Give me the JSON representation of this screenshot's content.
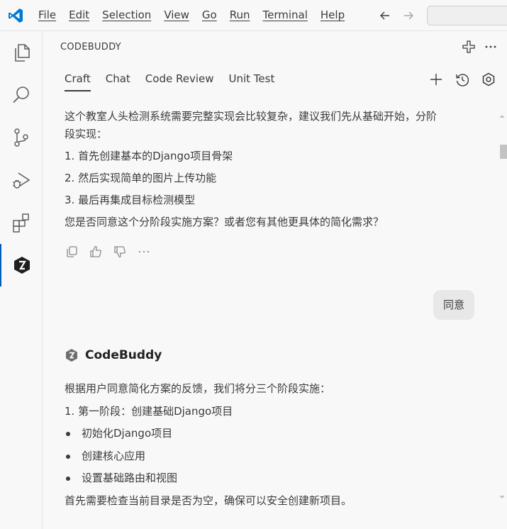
{
  "menu": [
    "File",
    "Edit",
    "Selection",
    "View",
    "Go",
    "Run",
    "Terminal",
    "Help"
  ],
  "panel": {
    "title": "CODEBUDDY",
    "tabs": [
      "Craft",
      "Chat",
      "Code Review",
      "Unit Test"
    ],
    "active_tab": "Craft"
  },
  "message1": {
    "clipped_line": "这个教室人头检测系统需要完整实现会比较复杂，建议我们先从基础开始，分阶",
    "lines": [
      "段实现：",
      "1. 首先创建基本的Django项目骨架",
      "2. 然后实现简单的图片上传功能",
      "3. 最后再集成目标检测模型",
      "您是否同意这个分阶段实施方案？或者您有其他更具体的简化需求？"
    ]
  },
  "user_reply": "同意",
  "bot": {
    "name": "CodeBuddy",
    "intro": "根据用户同意简化方案的反馈，我们将分三个阶段实施：",
    "phase": "1. 第一阶段：创建基础Django项目",
    "bullets": [
      "初始化Django项目",
      "创建核心应用",
      "设置基础路由和视图"
    ],
    "last_line": "首先需要检查当前目录是否为空，确保可以安全创建新项目。"
  },
  "colors": {
    "accent": "#005fb8",
    "vscode_blue": "#0078d4",
    "text": "#3b3b3b",
    "bubble": "#e8e8e8"
  }
}
